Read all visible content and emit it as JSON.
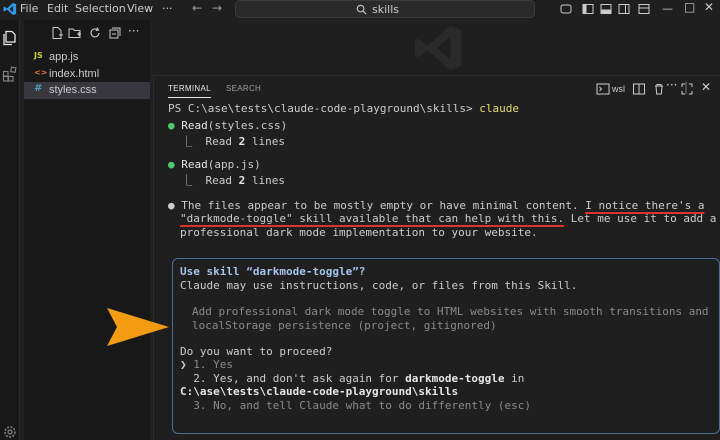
{
  "menu": {
    "items": [
      "File",
      "Edit",
      "Selection",
      "View"
    ],
    "more": "···"
  },
  "search": {
    "text": "skills"
  },
  "explorer": {
    "files": [
      {
        "icon": "JS",
        "name": "app.js",
        "icon_color": "#cbcb41"
      },
      {
        "icon": "<>",
        "name": "index.html",
        "icon_color": "#e37933"
      },
      {
        "icon": "#",
        "name": "styles.css",
        "icon_color": "#519aba"
      }
    ]
  },
  "panel": {
    "tabs": [
      "TERMINAL",
      "SEARCH"
    ],
    "shell": "wsl"
  },
  "terminal": {
    "prompt_path": "PS C:\\ase\\tests\\claude-code-playground\\skills> ",
    "prompt_cmd": "claude",
    "read1_tool": "Read",
    "read1_arg": "(styles.css)",
    "read1_result_prefix": "  ⎿  Read ",
    "read1_result_count": "2",
    "read1_result_suffix": " lines",
    "read2_tool": "Read",
    "read2_arg": "(app.js)",
    "read2_result_prefix": "  ⎿  Read ",
    "read2_result_count": "2",
    "read2_result_suffix": " lines",
    "msg_line1_a": "The files appear to be mostly empty or have minimal content. ",
    "msg_line1_b": "I notice there's a",
    "msg_line2_a": "\"darkmode-toggle\" skill available that can help with this.",
    "msg_line2_b": " Let me use it to add a",
    "msg_line3": "professional dark mode implementation to your website."
  },
  "dialog": {
    "title": "Use skill “darkmode-toggle”?",
    "subtitle": "Claude may use instructions, code, or files from this Skill.",
    "desc_line1": "Add professional dark mode toggle to HTML websites with smooth transitions and",
    "desc_line2": "localStorage persistence (project, gitignored)",
    "question": "Do you want to proceed?",
    "opt1_num": "1. ",
    "opt1_label": "Yes",
    "opt2_a": "2. Yes, and don't ask again for ",
    "opt2_b": "darkmode-toggle",
    "opt2_c": " in",
    "opt2_path": "C:\\ase\\tests\\claude-code-playground\\skills",
    "opt3_a": "3. No, and tell Claude what to do differently ",
    "opt3_b": "(esc)"
  },
  "colors": {
    "accent_orange": "#f39c12",
    "bullet_green": "#4ec970",
    "underline_red": "#e03131",
    "dialog_border": "#4d6e94"
  }
}
